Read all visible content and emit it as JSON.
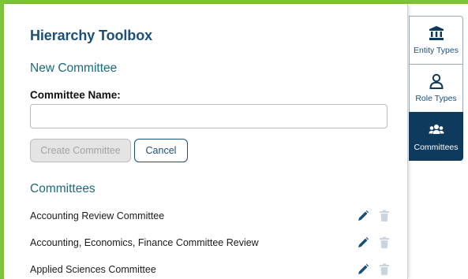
{
  "panel": {
    "title": "Hierarchy Toolbox",
    "new_committee": {
      "heading": "New Committee",
      "name_label": "Committee Name:",
      "name_value": "",
      "name_placeholder": "",
      "create_label": "Create Committee",
      "cancel_label": "Cancel"
    },
    "committees": {
      "heading": "Committees",
      "items": [
        {
          "name": "Accounting Review Committee"
        },
        {
          "name": "Accounting, Economics, Finance Committee Review"
        },
        {
          "name": "Applied Sciences Committee"
        }
      ]
    }
  },
  "sidebar": {
    "items": [
      {
        "label": "Entity Types",
        "icon": "building-icon",
        "active": false
      },
      {
        "label": "Role Types",
        "icon": "person-icon",
        "active": false
      },
      {
        "label": "Committees",
        "icon": "users-icon",
        "active": true
      }
    ]
  },
  "colors": {
    "frame_accent": "#7dc33a",
    "title": "#1a4f7a",
    "section": "#1a6a7a",
    "active_tab": "#0e3a5e",
    "edit_icon": "#1a4f7a",
    "delete_icon": "#c9d4de"
  }
}
